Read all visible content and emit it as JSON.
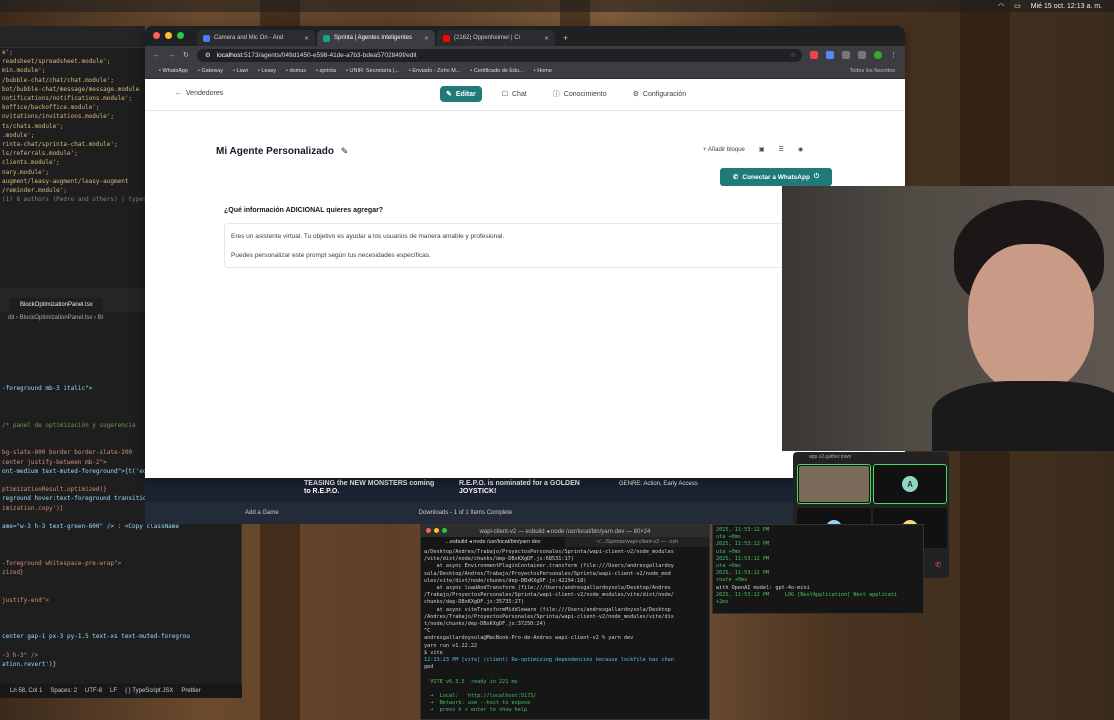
{
  "menubar": {
    "datetime": "Mié 15 oct. 12:13 a. m."
  },
  "editor": {
    "code_top": [
      "e';",
      "readsheet/spreadsheet.module';",
      "min.module';",
      "/bubble-chat/chat/chat.module';",
      "bot/bubble-chat/message/message.module",
      "notifications/notifications.module';",
      "koffice/backoffice.module';",
      "nvitations/invitations.module';",
      "ts/chats.module';",
      ".module';",
      "rinta-chat/sprinta-chat.module';",
      "ls/referrals.module';",
      "clients.module';",
      "nary.module';",
      "augment/leasy-augment/leasy-augment",
      "/reminder.module';"
    ],
    "code_top_comment": "  (1) 8 authors (Pedro and others)  |  typescript  Class",
    "tab_label": "BlockOptimizationPanel.tsx",
    "breadcrumb": "dit  ›  BlockOptimizationPanel.tsx  ›  Bl",
    "code_bottom": [
      "-foreground mb-3 italic\">",
      "",
      "",
      "",
      "/* panel de optimización y sugerencia",
      "",
      "",
      "bg-slate-800 border border-slate-200",
      "center justify-between mb-2\">",
      "ont-medium text-muted-foreground\">{t('edit.edito",
      "",
      "ptimizationResult.optimized)}",
      "reground hover:text-foreground transition-colors",
      "imization.copy')}",
      "",
      "ame=\"w-3 h-3 text-green-600\" /> : <Copy className",
      "",
      "",
      "",
      "-foreground whitespace-pre-wrap\">",
      "zized}",
      "",
      "",
      " justify-end\">",
      "",
      "",
      "",
      "center gap-1 px-3 py-1.5 text-xs text-muted-foregrou",
      "",
      "-3 h-3\" />",
      "ation.revert')}"
    ],
    "status": [
      "Ln 58, Col 1",
      "Spaces: 2",
      "UTF-8",
      "LF",
      "{ } TypeScript JSX",
      "Prettier"
    ]
  },
  "browser": {
    "tabs": [
      {
        "label": "Camera and Mic On - And",
        "color": "#4a7dff"
      },
      {
        "label": "Sprinta | Agentes Inteligentes",
        "color": "#1f9d8b",
        "active": true
      },
      {
        "label": "(2162) Oppenheimer | Ci",
        "color": "#ff0000"
      }
    ],
    "new_tab": "+",
    "url_host": "localhost",
    "url_rest": ":5173/agents/049d1450-e598-41de-a7b3-bdea5702849f/edit",
    "bookmarks": [
      "WhatsApp",
      "Gateway",
      "Lawi",
      "Leasy",
      "domus",
      "sprinta",
      "UNIR: Secretaría |...",
      "Enviado - Zoho M...",
      "Certificado de Edu...",
      "Home"
    ],
    "bookmarks_all": "Todos los favoritos"
  },
  "app": {
    "back_label": "Vendedores",
    "tabs": [
      {
        "icon": "✎",
        "label": "Editar",
        "active": true
      },
      {
        "icon": "☐",
        "label": "Chat"
      },
      {
        "icon": "ⓘ",
        "label": "Conocimiento"
      },
      {
        "icon": "⚙",
        "label": "Configuración"
      }
    ],
    "agent_title": "Mi Agente Personalizado",
    "add_block": "+ Añadir bloque",
    "whatsapp_button": "Conectar a WhatsApp",
    "question": "¿Qué información ADICIONAL quieres agregar?",
    "prompt_lines": [
      "Eres un asistente virtual. Tu objetivo es ayudar a los usuarios de manera amable y profesional.",
      "Puedes personalizar este prompt según tus necesidades específicas."
    ]
  },
  "game_strip": {
    "banner1": "TEASING the NEW MONSTERS coming to R.E.P.O.",
    "banner2": "R.E.P.O. is nominated for a GOLDEN JOYSTICK!",
    "genre": "GENRE: Action, Early Access",
    "foot_left": "Add a Game",
    "foot_center": "Downloads - 1 of 1 Items Complete"
  },
  "meeting": {
    "header": "app.v2.gather.town",
    "tiles": [
      {
        "letter": "",
        "color": "#7a6a5a"
      },
      {
        "letter": "A",
        "color": "#8fd6c8"
      },
      {
        "letter": "S",
        "color": "#9ad0f5"
      },
      {
        "letter": "B",
        "color": "#f5d77a"
      }
    ],
    "self_initial": "A"
  },
  "terminal": {
    "title": "wapi-client-v2 — esbuild ◂ node /usr/local/bin/yarn dev — 80×24",
    "tab1": "...esbuild ◂ node /usr/local/bin/yarn dev",
    "tab2": "~/.../Sprinta/wapi-client-v2 — -zsh",
    "lines": [
      "a/Desktop/Andres/Trabajo/ProyectosPersonales/Sprinta/wapi-client-v2/node_modules",
      "/vite/dist/node/chunks/dep-DBxKXgDF.js:68531:17)",
      "    at async EnvironmentPluginContainer.transform (file:///Users/andresgallardoy",
      "sola/Desktop/Andres/Trabajo/ProyectosPersonales/Sprinta/wapi-client-v2/node_mod",
      "ules/vite/dist/node/chunks/dep-DBxKXgDF.js:42294:18)",
      "    at async loadAndTransform (file:///Users/andresgallardoysola/Desktop/Andres",
      "/Trabajo/ProyectosPersonales/Sprinta/wapi-client-v2/node_modules/vite/dist/node/",
      "chunks/dep-DBxKXgDF.js:35735:27)",
      "    at async viteTransformMiddleware (file:///Users/andresgallardoysola/Desktop",
      "/Andres/Trabajo/ProyectosPersonales/Sprinta/wapi-client-v2/node_modules/vite/dis",
      "t/node/chunks/dep-DBxKXgDF.js:37250:24)",
      "^C",
      "andresgallardoysola@MacBook-Pro-de-Andres wapi-client-v2 % yarn dev",
      "yarn run v1.22.22",
      "$ vite",
      "12:13:23 PM [vite] (client) Re-optimizing dependencies because lockfile has chan",
      "ged",
      "",
      "  VITE v6.3.5  ready in 221 ms",
      "",
      "  ➜  Local:   http://localhost:5173/",
      "  ➜  Network: use --host to expose",
      "  ➜  press h + enter to show help"
    ],
    "right_lines": [
      "2025, 11:53:12 PM",
      "uta +0ms",
      "2025, 11:53:12 PM",
      "uta +0ms",
      "2025, 11:53:12 PM",
      "uta +0ms",
      "2025, 11:53:12 PM",
      "route +0ms",
      "with OpenAI model: gpt-4o-mini",
      "2025, 11:53:12 PM     LOG [NestApplication] Nest applicati",
      "+2ms"
    ]
  }
}
